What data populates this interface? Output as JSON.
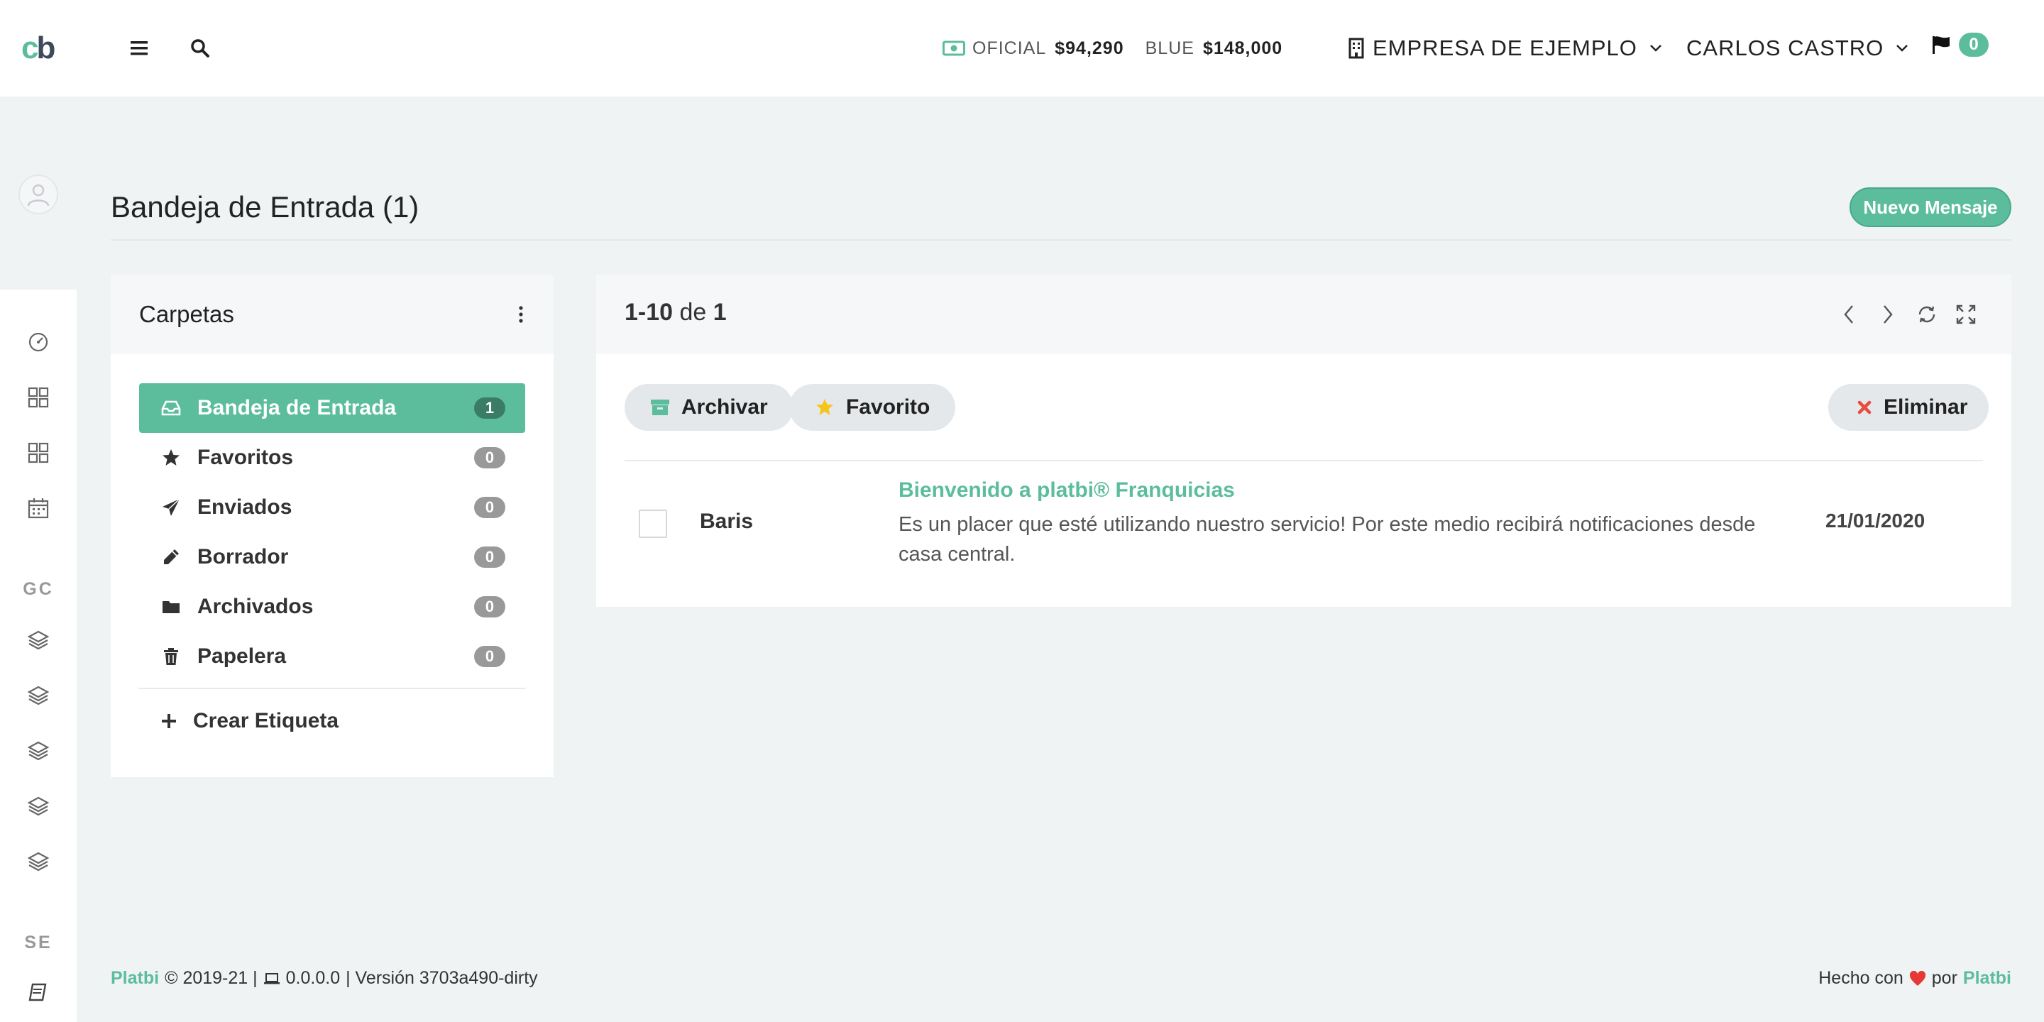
{
  "brand": {
    "logo_c": "c",
    "logo_b": "b"
  },
  "header": {
    "rates": {
      "oficial_label": "OFICIAL",
      "oficial_value": "$94,290",
      "blue_label": "BLUE",
      "blue_value": "$148,000"
    },
    "company": "EMPRESA DE EJEMPLO",
    "user": "CARLOS CASTRO",
    "notifications": "0"
  },
  "sidebar": {
    "section_gc": "GC",
    "section_se": "SE"
  },
  "page": {
    "title": "Bandeja de Entrada (1)",
    "new_message": "Nuevo Mensaje"
  },
  "folders": {
    "title": "Carpetas",
    "items": [
      {
        "label": "Bandeja de Entrada",
        "count": "1",
        "icon": "inbox-icon"
      },
      {
        "label": "Favoritos",
        "count": "0",
        "icon": "star-icon"
      },
      {
        "label": "Enviados",
        "count": "0",
        "icon": "paper-plane-icon"
      },
      {
        "label": "Borrador",
        "count": "0",
        "icon": "pencil-icon"
      },
      {
        "label": "Archivados",
        "count": "0",
        "icon": "folder-icon"
      },
      {
        "label": "Papelera",
        "count": "0",
        "icon": "trash-icon"
      }
    ],
    "create_label": "Crear Etiqueta"
  },
  "messages": {
    "range": "1-10",
    "of": "de",
    "total": "1",
    "actions": {
      "archive": "Archivar",
      "favorite": "Favorito",
      "delete": "Eliminar"
    },
    "rows": [
      {
        "sender": "Baris",
        "subject": "Bienvenido a platbi® Franquicias",
        "preview": "Es un placer que esté utilizando nuestro servicio! Por este medio recibirá notificaciones desde casa central.",
        "date": "21/01/2020"
      }
    ]
  },
  "footer": {
    "brand": "Platbi",
    "copyright": "© 2019-21 |",
    "version_num": "0.0.0.0",
    "version_text": "| Versión 3703a490-dirty",
    "made_with": "Hecho con",
    "by": "por",
    "brand_right": "Platbi"
  },
  "colors": {
    "accent": "#5cbd9d",
    "danger": "#e74c3c",
    "star": "#f5c518",
    "heart": "#e53935"
  }
}
